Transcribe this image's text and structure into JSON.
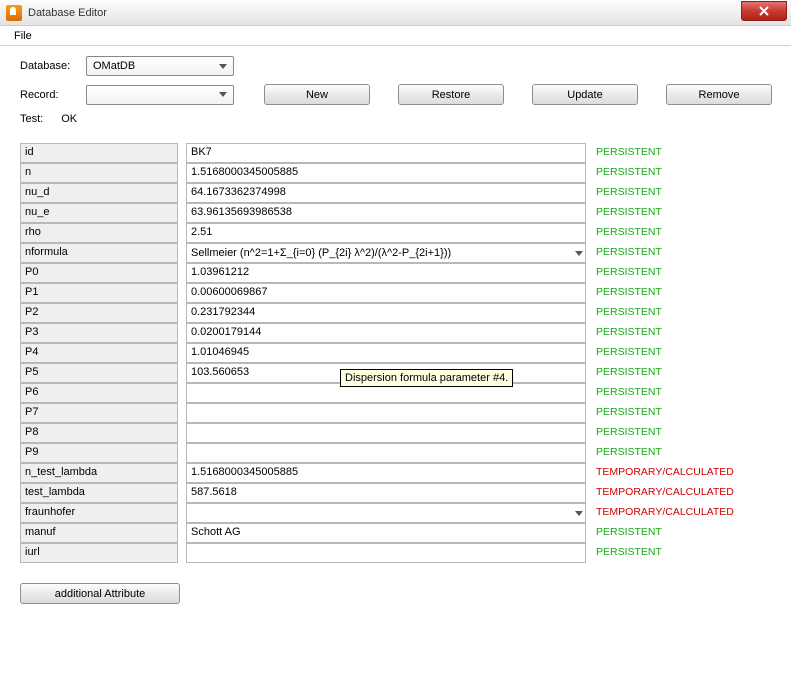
{
  "window": {
    "title": "Database Editor"
  },
  "menu": {
    "file": "File"
  },
  "labels": {
    "database": "Database:",
    "record": "Record:",
    "test": "Test:"
  },
  "database_value": "OMatDB",
  "record_value": "",
  "test_status": "OK",
  "buttons": {
    "new": "New",
    "restore": "Restore",
    "update": "Update",
    "remove": "Remove",
    "add_attr": "additional Attribute"
  },
  "status": {
    "persistent": "PERSISTENT",
    "temporary": "TEMPORARY/CALCULATED"
  },
  "tooltip": "Dispersion formula parameter #4.",
  "rows": [
    {
      "name": "id",
      "value": "BK7",
      "status": "persistent",
      "type": "text"
    },
    {
      "name": "n",
      "value": "1.5168000345005885",
      "status": "persistent",
      "type": "text"
    },
    {
      "name": "nu_d",
      "value": "64.1673362374998",
      "status": "persistent",
      "type": "text"
    },
    {
      "name": "nu_e",
      "value": "63.96135693986538",
      "status": "persistent",
      "type": "text"
    },
    {
      "name": "rho",
      "value": "2.51",
      "status": "persistent",
      "type": "text"
    },
    {
      "name": "nformula",
      "value": "Sellmeier (n^2=1+Σ_{i=0} (P_{2i} λ^2)/(λ^2-P_{2i+1}))",
      "status": "persistent",
      "type": "select"
    },
    {
      "name": "P0",
      "value": "1.03961212",
      "status": "persistent",
      "type": "text"
    },
    {
      "name": "P1",
      "value": "0.00600069867",
      "status": "persistent",
      "type": "text"
    },
    {
      "name": "P2",
      "value": "0.231792344",
      "status": "persistent",
      "type": "text"
    },
    {
      "name": "P3",
      "value": "0.0200179144",
      "status": "persistent",
      "type": "text"
    },
    {
      "name": "P4",
      "value": "1.01046945",
      "status": "persistent",
      "type": "text"
    },
    {
      "name": "P5",
      "value": "103.560653",
      "status": "persistent",
      "type": "text"
    },
    {
      "name": "P6",
      "value": "",
      "status": "persistent",
      "type": "text"
    },
    {
      "name": "P7",
      "value": "",
      "status": "persistent",
      "type": "text"
    },
    {
      "name": "P8",
      "value": "",
      "status": "persistent",
      "type": "text"
    },
    {
      "name": "P9",
      "value": "",
      "status": "persistent",
      "type": "text"
    },
    {
      "name": "n_test_lambda",
      "value": "1.5168000345005885",
      "status": "temporary",
      "type": "text"
    },
    {
      "name": "test_lambda",
      "value": "587.5618",
      "status": "temporary",
      "type": "text"
    },
    {
      "name": "fraunhofer",
      "value": "",
      "status": "temporary",
      "type": "select"
    },
    {
      "name": "manuf",
      "value": "Schott AG",
      "status": "persistent",
      "type": "text"
    },
    {
      "name": "iurl",
      "value": "",
      "status": "persistent",
      "type": "text"
    }
  ]
}
